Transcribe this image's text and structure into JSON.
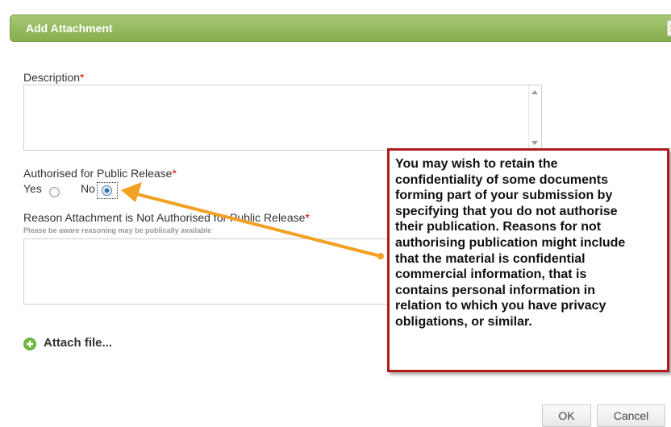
{
  "dialog": {
    "title": "Add Attachment",
    "close_icon": "close-icon"
  },
  "fields": {
    "description": {
      "label": "Description",
      "required_marker": "*",
      "value": ""
    },
    "public_release": {
      "label": "Authorised for Public Release",
      "required_marker": "*",
      "options": [
        {
          "label": "Yes",
          "checked": false
        },
        {
          "label": "No",
          "checked": true
        }
      ]
    },
    "reason": {
      "label": "Reason Attachment is Not Authorised for Public Release",
      "required_marker": "*",
      "hint": "Please be aware reasoning may be publically available",
      "value": ""
    }
  },
  "attach": {
    "label": "Attach file...",
    "icon": "add-circle-icon"
  },
  "buttons": {
    "ok": "OK",
    "cancel": "Cancel"
  },
  "callout": {
    "text": "You may wish to retain the\nconfidentiality of some documents\nforming part of your submission by\nspecifying that you do not authorise\ntheir publication.  Reasons for not\nauthorising publication might include\nthat the material is confidential\ncommercial information, that is\ncontains personal information in\nrelation to which you have privacy\nobligations, or similar.",
    "border_color": "#b31b1b"
  },
  "colors": {
    "accent_green": "#8ab356",
    "arrow_orange": "#f3a025",
    "required_red": "#cc0000"
  }
}
